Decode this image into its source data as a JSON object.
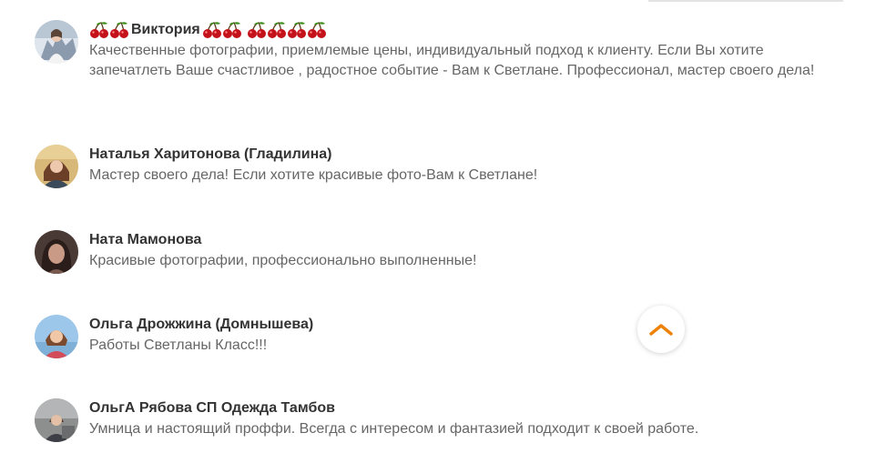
{
  "comments": [
    {
      "author": "Виктория",
      "text": "Качественные фотографии, приемлемые цены, индивидуальный подход к клиенту. Если Вы хотите запечатлеть Ваше счастливое , радостное событие - Вам к Светлане. Профессионал, мастер своего дела!",
      "avatar_icon": "avatar-photo-icon"
    },
    {
      "author": "Наталья Харитонова (Гладилина)",
      "text": "Мастер своего дела! Если хотите красивые фото-Вам к Светлане!",
      "avatar_icon": "avatar-photo-icon"
    },
    {
      "author": "Ната Мамонова",
      "text": "Красивые фотографии, профессионально выполненные!",
      "avatar_icon": "avatar-photo-icon"
    },
    {
      "author": "Ольга Дрожжина (Домнышева)",
      "text": "Работы Светланы Класс!!!",
      "avatar_icon": "avatar-photo-icon"
    },
    {
      "author": "ОльгА Рябова СП Одежда Тамбов",
      "text": "Умница и настоящий проффи. Всегда с интересом и фантазией подходит к своей работе.",
      "avatar_icon": "avatar-photo-icon"
    }
  ],
  "decorations": {
    "cherry_icon": "cherry-emoji-icon",
    "cherry_color": "#c4121a",
    "leaf_color": "#3f8f1f"
  },
  "scroll_top_button": {
    "icon": "chevron-up-icon",
    "color": "#ee8208"
  },
  "colors": {
    "author": "#333333",
    "text": "#666666",
    "background": "#ffffff"
  }
}
